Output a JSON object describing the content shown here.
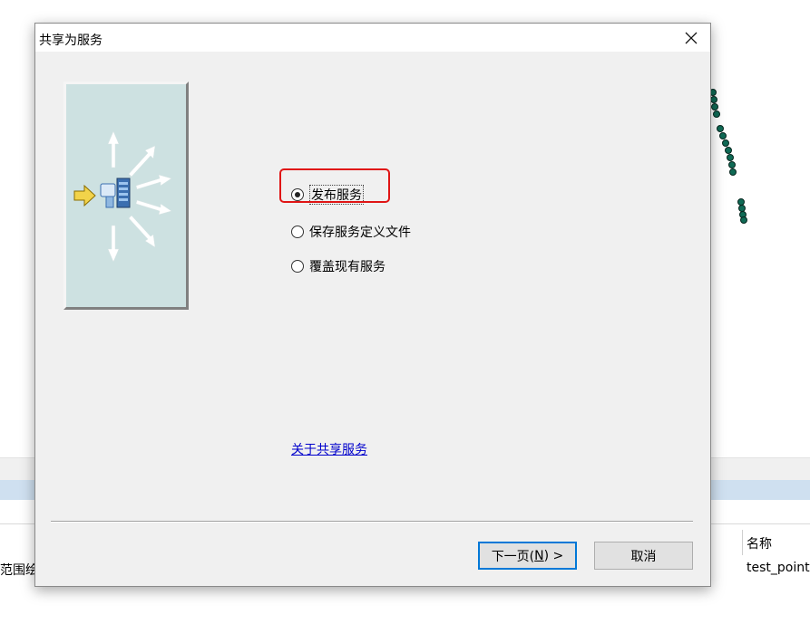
{
  "dialog": {
    "title": "共享为服务",
    "options": [
      {
        "label": "发布服务",
        "selected": true
      },
      {
        "label": "保存服务定义文件",
        "selected": false
      },
      {
        "label": "覆盖现有服务",
        "selected": false
      }
    ],
    "link": "关于共享服务",
    "buttons": {
      "next_prefix": "下一页(",
      "next_mnemonic": "N",
      "next_suffix": ") >",
      "cancel": "取消"
    }
  },
  "background": {
    "table_header_name": "名称",
    "left_cell": "范围绘制",
    "right_cell": "test_point"
  },
  "colors": {
    "highlight": "#e01515",
    "link": "#0000cc",
    "primary_border": "#0078d7",
    "map_points": "#0f6a55"
  },
  "icons": [
    "close-icon",
    "publish-service-illustration",
    "yellow-arrow-icon",
    "server-icon"
  ]
}
